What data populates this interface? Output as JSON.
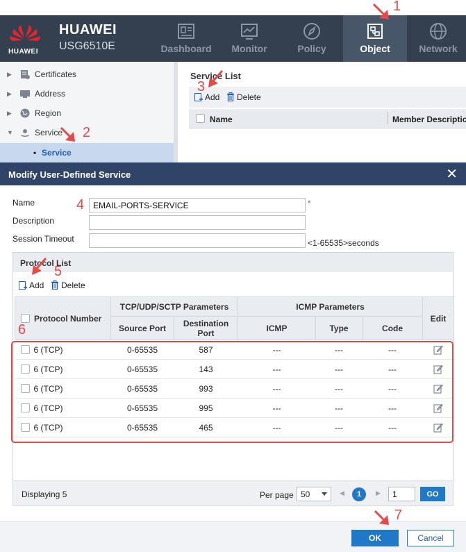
{
  "header": {
    "brand": "HUAWEI",
    "model": "USG6510E",
    "logo_text": "HUAWEI",
    "nav": [
      {
        "label": "Dashboard",
        "icon": "dashboard-icon"
      },
      {
        "label": "Monitor",
        "icon": "monitor-icon"
      },
      {
        "label": "Policy",
        "icon": "policy-compass-icon"
      },
      {
        "label": "Object",
        "icon": "object-icon",
        "active": true
      },
      {
        "label": "Network",
        "icon": "network-globe-icon"
      }
    ]
  },
  "sidebar": {
    "items": [
      {
        "label": "Certificates",
        "icon": "certificate-icon"
      },
      {
        "label": "Address",
        "icon": "address-icon"
      },
      {
        "label": "Region",
        "icon": "region-globe-icon"
      },
      {
        "label": "Service",
        "icon": "service-icon"
      }
    ],
    "selected_child": "Service"
  },
  "service_list": {
    "title": "Service List",
    "add_label": "Add",
    "delete_label": "Delete",
    "col_name": "Name",
    "col_member": "Member Description"
  },
  "modal": {
    "title": "Modify User-Defined Service",
    "close_glyph": "✕",
    "fields": {
      "name_label": "Name",
      "name_value": "EMAIL-PORTS-SERVICE",
      "required_mark": "*",
      "description_label": "Description",
      "description_value": "",
      "timeout_label": "Session Timeout",
      "timeout_value": "",
      "timeout_hint": "<1-65535>seconds"
    },
    "protocol_list": {
      "title": "Protocol List",
      "add_label": "Add",
      "delete_label": "Delete",
      "headers": {
        "protocol": "Protocol Number",
        "tcp_group": "TCP/UDP/SCTP Parameters",
        "source_port": "Source Port",
        "dest_port": "Destination Port",
        "icmp_group": "ICMP Parameters",
        "icmp": "ICMP",
        "type": "Type",
        "code": "Code",
        "edit": "Edit"
      },
      "rows": [
        {
          "protocol": "6 (TCP)",
          "source": "0-65535",
          "dest": "587",
          "icmp": "---",
          "type": "---",
          "code": "---"
        },
        {
          "protocol": "6 (TCP)",
          "source": "0-65535",
          "dest": "143",
          "icmp": "---",
          "type": "---",
          "code": "---"
        },
        {
          "protocol": "6 (TCP)",
          "source": "0-65535",
          "dest": "993",
          "icmp": "---",
          "type": "---",
          "code": "---"
        },
        {
          "protocol": "6 (TCP)",
          "source": "0-65535",
          "dest": "995",
          "icmp": "---",
          "type": "---",
          "code": "---"
        },
        {
          "protocol": "6 (TCP)",
          "source": "0-65535",
          "dest": "465",
          "icmp": "---",
          "type": "---",
          "code": "---"
        }
      ]
    },
    "pager": {
      "displaying": "Displaying 5",
      "per_page_label": "Per page",
      "per_page_value": "50",
      "current_page": "1",
      "page_input": "1",
      "go_label": "GO"
    },
    "ok_label": "OK",
    "cancel_label": "Cancel"
  },
  "annotations": {
    "steps": [
      "1",
      "2",
      "3",
      "4",
      "5",
      "6",
      "7"
    ]
  },
  "colors": {
    "header_bg": "#34404f",
    "modal_head": "#2f4467",
    "accent": "#1f78c8",
    "annotation_red": "#e04747"
  }
}
